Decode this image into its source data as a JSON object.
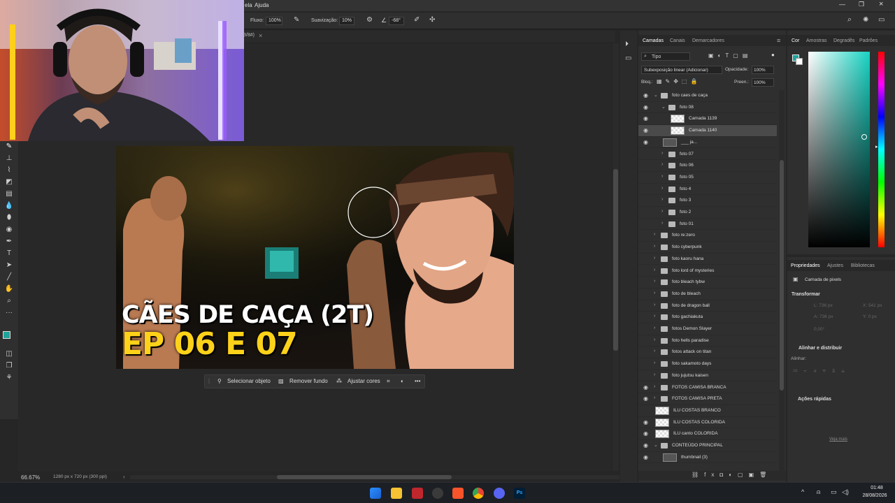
{
  "menu": {
    "items": [
      "ela",
      "Ajuda"
    ]
  },
  "options": {
    "flow_label": "Fluxo:",
    "flow_value": "100%",
    "smoothing_label": "Suavização:",
    "smoothing_value": "10%",
    "angle_value": "-68°"
  },
  "doc_tab": {
    "label": "3/8#)",
    "close": "×"
  },
  "canvas": {
    "zoom": "66.67%",
    "doc_info": "1280 px x 720 px (300 ppi)",
    "thumbnail_text": {
      "line1": "CÃES DE CAÇA (2T)",
      "line2": "EP 06 E 07"
    }
  },
  "context_bar": {
    "select_subject": "Selecionar objeto",
    "remove_bg": "Remover fundo",
    "adjust_colors": "Ajustar cores",
    "more": "•••"
  },
  "layers_panel": {
    "tabs": [
      "Camadas",
      "Canais",
      "Demarcadores"
    ],
    "filter_label": "Tipo",
    "blend_mode": "Subexposição linear (Adicionar)",
    "opacity_label": "Opacidade:",
    "opacity_value": "100%",
    "lock_label": "Bloq.:",
    "fill_label": "Preen.:",
    "fill_value": "100%",
    "layers": [
      {
        "name": "foto caes de caça",
        "visible": true,
        "kind": "group",
        "indent": 0,
        "open": true
      },
      {
        "name": "foto 08",
        "visible": true,
        "kind": "group",
        "indent": 1,
        "open": true
      },
      {
        "name": "Camada 1139",
        "visible": true,
        "kind": "pixel",
        "indent": 2
      },
      {
        "name": "Camada 1140",
        "visible": true,
        "kind": "pixel",
        "indent": 2,
        "selected": true
      },
      {
        "name": "___ ja...",
        "visible": true,
        "kind": "smart",
        "indent": 1
      },
      {
        "name": "foto 07",
        "visible": false,
        "kind": "group",
        "indent": 1
      },
      {
        "name": "foto 06",
        "visible": false,
        "kind": "group",
        "indent": 1
      },
      {
        "name": "foto 05",
        "visible": false,
        "kind": "group",
        "indent": 1
      },
      {
        "name": "foto 4",
        "visible": false,
        "kind": "group",
        "indent": 1
      },
      {
        "name": "foto 3",
        "visible": false,
        "kind": "group",
        "indent": 1
      },
      {
        "name": "foto 2",
        "visible": false,
        "kind": "group",
        "indent": 1
      },
      {
        "name": "foto 01",
        "visible": false,
        "kind": "group",
        "indent": 1
      },
      {
        "name": "foto re:zero",
        "visible": false,
        "kind": "group",
        "indent": 0
      },
      {
        "name": "foto cyberpunk",
        "visible": false,
        "kind": "group",
        "indent": 0
      },
      {
        "name": "foto kaoru hana",
        "visible": false,
        "kind": "group",
        "indent": 0
      },
      {
        "name": "foto lord of mysteries",
        "visible": false,
        "kind": "group",
        "indent": 0
      },
      {
        "name": "foto bleach tybw",
        "visible": false,
        "kind": "group",
        "indent": 0
      },
      {
        "name": "foto de bleach",
        "visible": false,
        "kind": "group",
        "indent": 0
      },
      {
        "name": "foto de dragon ball",
        "visible": false,
        "kind": "group",
        "indent": 0
      },
      {
        "name": "foto gachiakuta",
        "visible": false,
        "kind": "group",
        "indent": 0
      },
      {
        "name": "fotos Demon Slayer",
        "visible": false,
        "kind": "group",
        "indent": 0
      },
      {
        "name": "foto hells paradise",
        "visible": false,
        "kind": "group",
        "indent": 0
      },
      {
        "name": "fotos  attack on titan",
        "visible": false,
        "kind": "group",
        "indent": 0
      },
      {
        "name": "foto sakamoto days",
        "visible": false,
        "kind": "group",
        "indent": 0
      },
      {
        "name": "foto jujutsu kaisen",
        "visible": false,
        "kind": "group",
        "indent": 0
      },
      {
        "name": "FOTOS CAMISA BRANCA",
        "visible": true,
        "kind": "group",
        "indent": 0
      },
      {
        "name": "FOTOS CAMISA PRETA",
        "visible": true,
        "kind": "group",
        "indent": 0
      },
      {
        "name": "ILU COSTAS BRANCO",
        "visible": false,
        "kind": "pixel",
        "indent": 0
      },
      {
        "name": "ILU COSTAS COLORIDA",
        "visible": true,
        "kind": "pixel",
        "indent": 0
      },
      {
        "name": "ILU canto COLORIDA",
        "visible": true,
        "kind": "pixel",
        "indent": 0
      },
      {
        "name": "CONTEÚDO PRINCIPAL",
        "visible": true,
        "kind": "group",
        "indent": 0,
        "open": true
      },
      {
        "name": "thumbnail (3)",
        "visible": true,
        "kind": "smart",
        "indent": 1
      }
    ]
  },
  "color_panel": {
    "tabs": [
      "Cor",
      "Amostras",
      "Degradês",
      "Padrões"
    ],
    "fg": "#1fa39a",
    "bg": "#ffffff",
    "hue": "#17d3c3"
  },
  "properties_panel": {
    "tabs": [
      "Propriedades",
      "Ajustes",
      "Bibliotecas"
    ],
    "layer_type": "Camada de pixels",
    "transform": "Transformar",
    "w": "L: 736 px",
    "h": "A: 736 px",
    "x": "X: 541 px",
    "y": "Y: 0 px",
    "angle": "0,00°",
    "align": "Alinhar e distribuir",
    "align_sub": "Alinhar:",
    "quick": "Ações rápidas",
    "more_link": "Veja mais"
  },
  "taskbar": {
    "time": "01:48",
    "date": "28/08/2026"
  }
}
